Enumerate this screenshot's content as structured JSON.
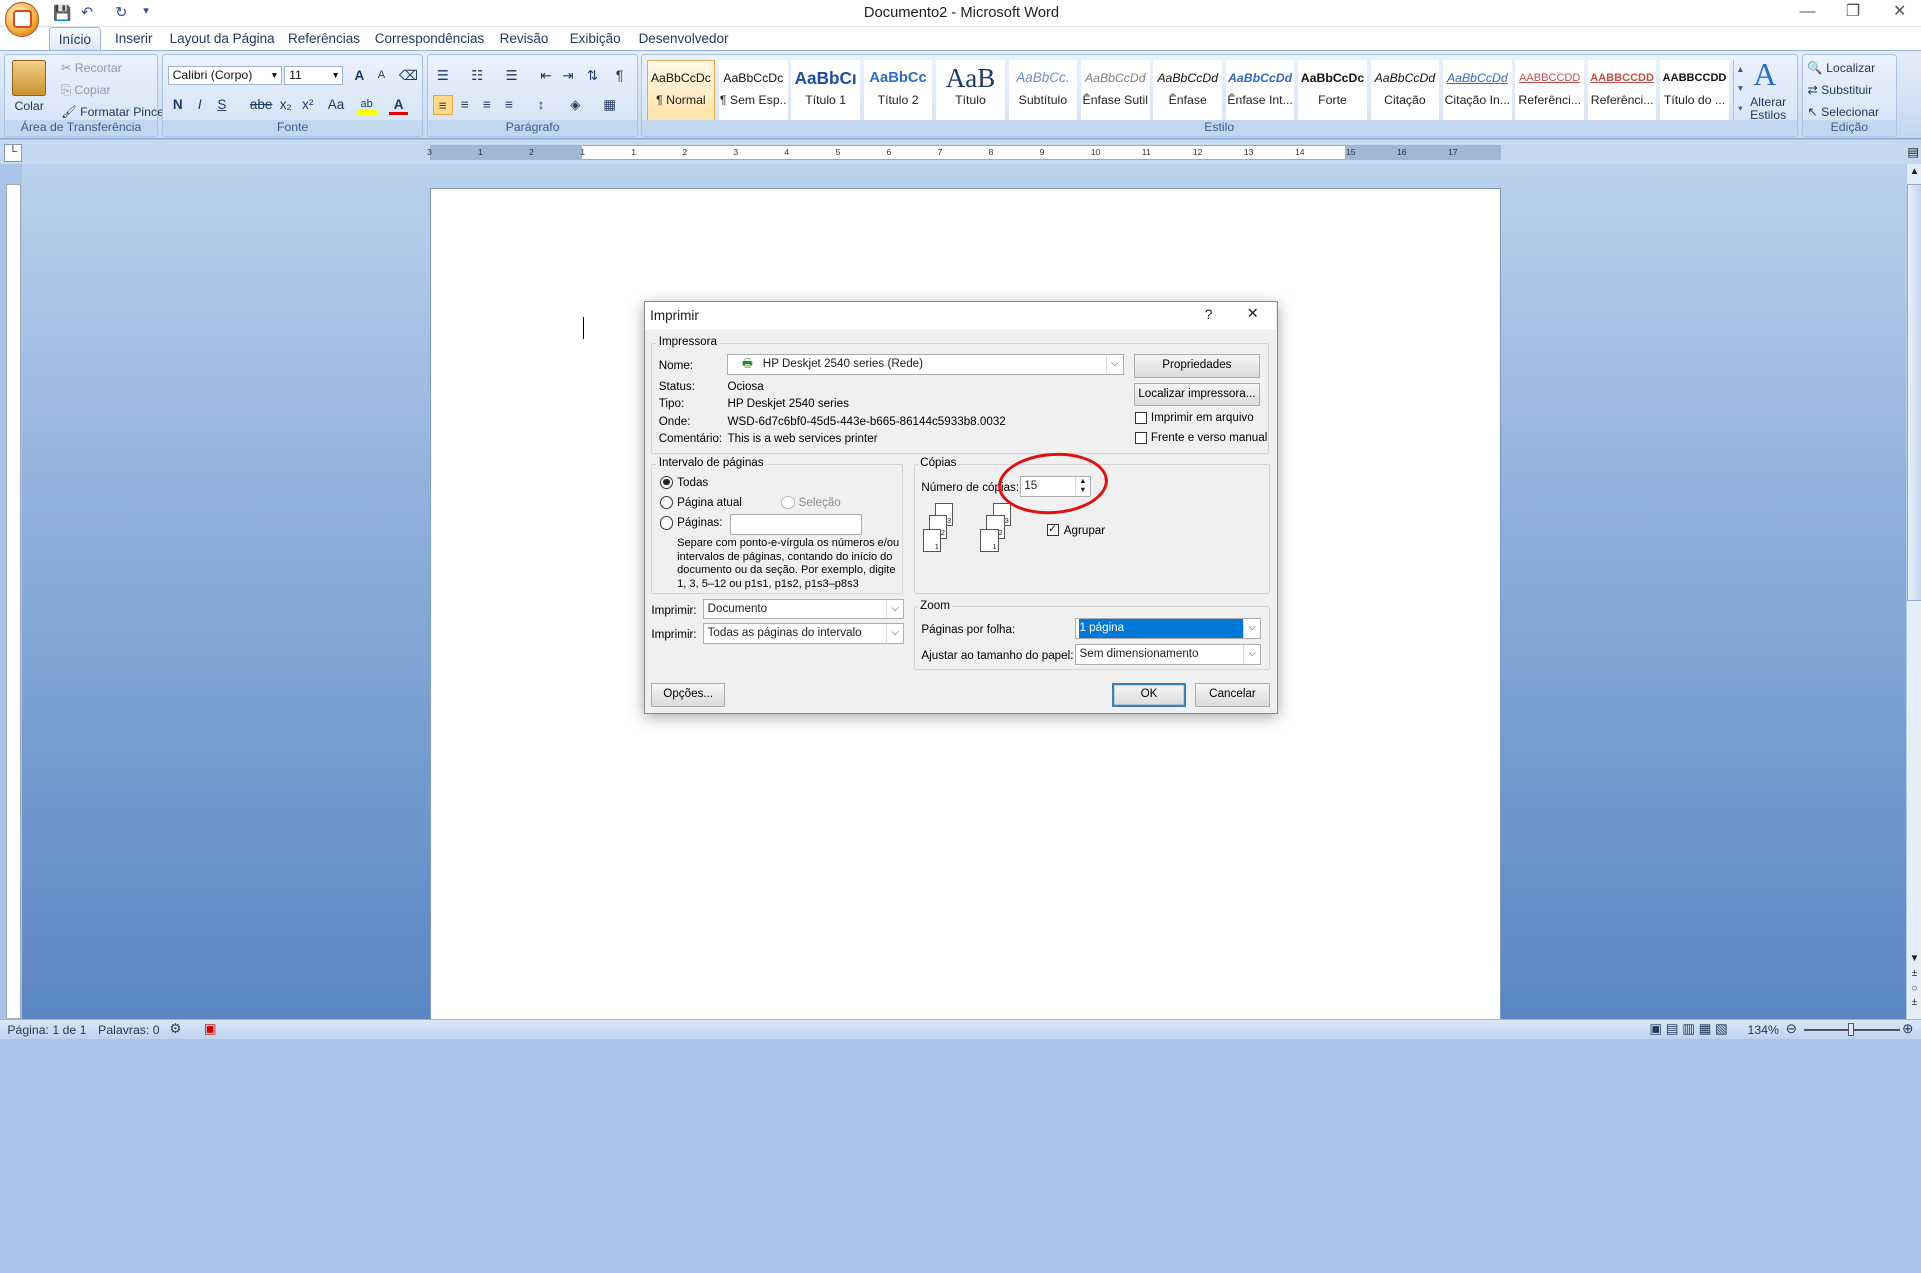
{
  "window": {
    "title": "Documento2 - Microsoft Word"
  },
  "tabs": [
    "Início",
    "Inserir",
    "Layout da Página",
    "Referências",
    "Correspondências",
    "Revisão",
    "Exibição",
    "Desenvolvedor"
  ],
  "clipboard": {
    "paste": "Colar",
    "cut": "Recortar",
    "copy": "Copiar",
    "format_painter": "Formatar Pincel",
    "label": "Área de Transferência"
  },
  "font": {
    "family": "Calibri (Corpo)",
    "size": "11",
    "label": "Fonte",
    "bold": "N",
    "italic": "I",
    "underline": "S",
    "strike": "abe",
    "sub": "x₂",
    "sup": "x²",
    "case": "Aa",
    "grow": "A",
    "shrink": "A",
    "highlight": "ab",
    "color": "A"
  },
  "paragraph": {
    "label": "Parágrafo"
  },
  "styles": {
    "label": "Estilo",
    "items": [
      {
        "preview": "AaBbCcDc",
        "name": "¶ Normal"
      },
      {
        "preview": "AaBbCcDc",
        "name": "¶ Sem Esp..."
      },
      {
        "preview": "AaBbCı",
        "name": "Título 1"
      },
      {
        "preview": "AaBbCc",
        "name": "Título 2"
      },
      {
        "preview": "AaB",
        "name": "Título"
      },
      {
        "preview": "AaBbCc.",
        "name": "Subtítulo"
      },
      {
        "preview": "AaBbCcDd",
        "name": "Ênfase Sutil"
      },
      {
        "preview": "AaBbCcDd",
        "name": "Ênfase"
      },
      {
        "preview": "AaBbCcDd",
        "name": "Ênfase Int..."
      },
      {
        "preview": "AaBbCcDc",
        "name": "Forte"
      },
      {
        "preview": "AaBbCcDd",
        "name": "Citação"
      },
      {
        "preview": "AaBbCcDd",
        "name": "Citação In..."
      },
      {
        "preview": "AABBCCDD",
        "name": "Referênci..."
      },
      {
        "preview": "AABBCCDD",
        "name": "Referênci..."
      },
      {
        "preview": "AABBCCDD",
        "name": "Título do ..."
      }
    ],
    "change": "Alterar Estilos"
  },
  "editing": {
    "label": "Edição",
    "find": "Localizar",
    "replace": "Substituir",
    "select": "Selecionar"
  },
  "ruler": {
    "ticks": [
      "3",
      "1",
      "2",
      "1",
      "1",
      "2",
      "3",
      "4",
      "5",
      "6",
      "7",
      "8",
      "9",
      "10",
      "11",
      "12",
      "13",
      "14",
      "15",
      "16",
      "17"
    ]
  },
  "status": {
    "page": "Página: 1 de 1",
    "words": "Palavras: 0",
    "zoom": "134%"
  },
  "dialog": {
    "title": "Imprimir",
    "help": "?",
    "close": "✕",
    "printer": {
      "legend": "Impressora",
      "name_label": "Nome:",
      "name": "HP Deskjet 2540 series (Rede)",
      "status_label": "Status:",
      "status": "Ociosa",
      "type_label": "Tipo:",
      "type": "HP Deskjet 2540 series",
      "where_label": "Onde:",
      "where": "WSD-6d7c6bf0-45d5-443e-b665-86144c5933b8.0032",
      "comment_label": "Comentário:",
      "comment": "This is a web services printer",
      "properties": "Propriedades",
      "find_printer": "Localizar impressora...",
      "print_to_file": "Imprimir em arquivo",
      "manual_duplex": "Frente e verso manual"
    },
    "range": {
      "legend": "Intervalo de páginas",
      "all": "Todas",
      "current": "Página atual",
      "selection": "Seleção",
      "pages": "Páginas:",
      "help": "Separe com ponto-e-vírgula os números e/ou intervalos de páginas, contando do início do documento ou da seção. Por exemplo, digite 1, 3, 5–12 ou p1s1, p1s2, p1s3–p8s3"
    },
    "copies": {
      "legend": "Cópias",
      "number_label": "Número de cópias:",
      "number": "15",
      "collate": "Agrupar"
    },
    "print_what_label": "Imprimir:",
    "print_what": "Documento",
    "print_label": "Imprimir:",
    "print": "Todas as páginas do intervalo",
    "zoom": {
      "legend": "Zoom",
      "per_sheet_label": "Páginas por folha:",
      "per_sheet": "1 página",
      "scale_label": "Ajustar ao tamanho do papel:",
      "scale": "Sem dimensionamento"
    },
    "options": "Opções...",
    "ok": "OK",
    "cancel": "Cancelar"
  }
}
